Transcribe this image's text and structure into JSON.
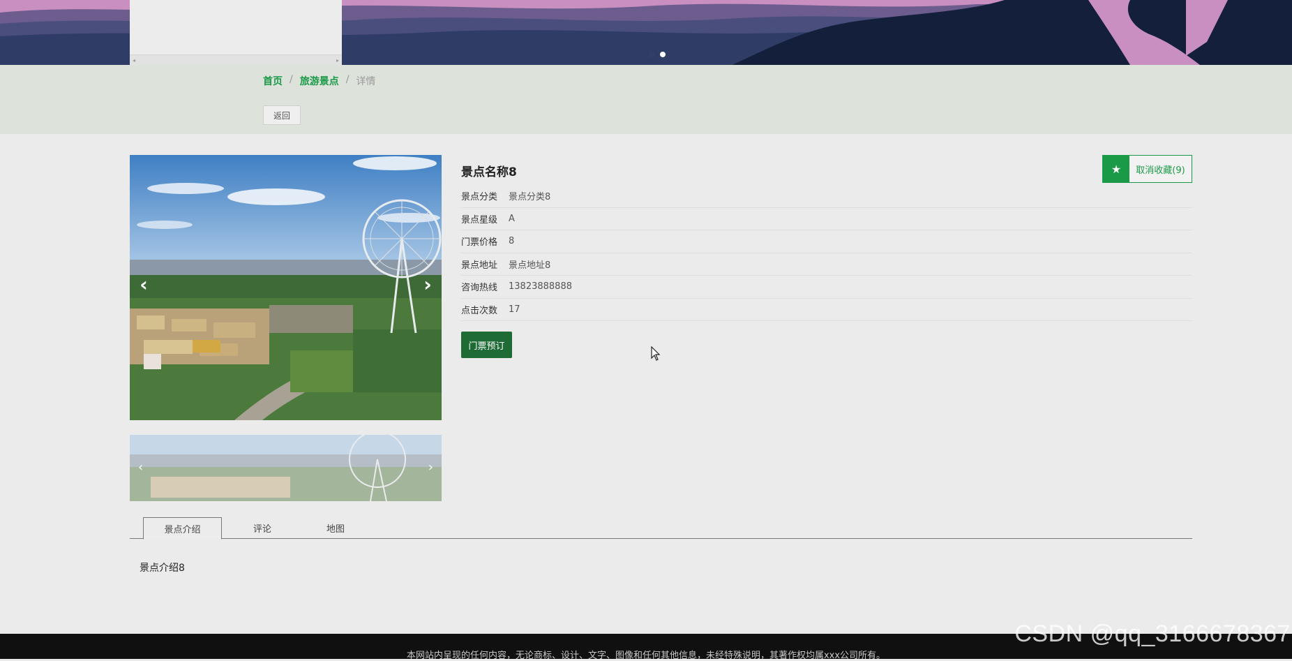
{
  "breadcrumb": {
    "home": "首页",
    "spots": "旅游景点",
    "current": "详情",
    "separator": "/"
  },
  "back_label": "返回",
  "spot": {
    "name": "景点名称8",
    "favorite_label": "取消收藏(9)",
    "rows": [
      {
        "key": "景点分类",
        "value": "景点分类8"
      },
      {
        "key": "景点星级",
        "value": "A"
      },
      {
        "key": "门票价格",
        "value": "8"
      },
      {
        "key": "景点地址",
        "value": "景点地址8"
      },
      {
        "key": "咨询热线",
        "value": "13823888888"
      },
      {
        "key": "点击次数",
        "value": "17"
      }
    ],
    "book_label": "门票预订"
  },
  "gallery": {
    "prev_icon": "chevron-left-icon",
    "next_icon": "chevron-right-icon",
    "prev_glyph": "‹",
    "next_glyph": "›"
  },
  "tabs": [
    {
      "label": "景点介绍",
      "active": true
    },
    {
      "label": "评论",
      "active": false
    },
    {
      "label": "地图",
      "active": false
    }
  ],
  "tab_content": "景点介绍8",
  "footer": {
    "text": "本网站内呈现的任何内容，无论商标、设计、文字、图像和任何其他信息，未经特殊说明，其著作权均属xxx公司所有。"
  },
  "watermark": "CSDN @qq_3166678367",
  "banner": {
    "slide_count": 2,
    "active_slide": 2
  },
  "colors": {
    "accent": "#1a9a46",
    "book_button": "#1e6b35",
    "footer": "#101010"
  }
}
